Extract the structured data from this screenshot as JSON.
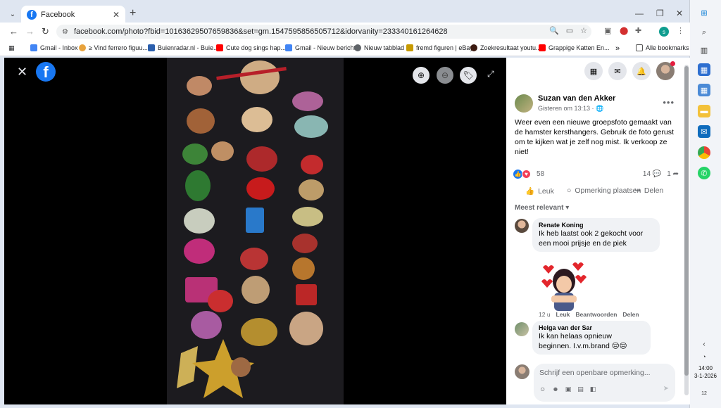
{
  "browser": {
    "tab": {
      "title": "Facebook"
    },
    "url": "facebook.com/photo?fbid=10163629507659836&set=gm.1547595856505712&idorvanity=233340161264628",
    "bookmarks": [
      {
        "label": "Gmail - Inbox",
        "icon": "google-icon",
        "color": "#4285f4"
      },
      {
        "label": "≥ Vind ferrero figuu...",
        "icon": "number-badge-icon",
        "color": "#e8a33d"
      },
      {
        "label": "Buienradar.nl - Buie...",
        "icon": "buienradar-icon",
        "color": "#2b5fad"
      },
      {
        "label": "Cute dog sings hap...",
        "icon": "youtube-icon",
        "color": "#ff0000"
      },
      {
        "label": "Gmail - Nieuw bericht",
        "icon": "google-icon",
        "color": "#4285f4"
      },
      {
        "label": "Nieuw tabblad",
        "icon": "globe-icon",
        "color": "#5f6368"
      },
      {
        "label": "fremd figuren | eBay",
        "icon": "ebay-icon",
        "color": "#c79a00"
      },
      {
        "label": "Zoekresultaat youtu...",
        "icon": "circle-icon",
        "color": "#3c1a10"
      },
      {
        "label": "Grappige Katten En...",
        "icon": "youtube-icon",
        "color": "#ff0000"
      }
    ],
    "all_bookmarks": "Alle bookmarks",
    "profile_initial": "s"
  },
  "post": {
    "author": "Suzan van den Akker",
    "time": "Gisteren om 13:13 · ",
    "text": "Weer even een nieuwe groepsfoto gemaakt van de hamster kersthangers. Gebruik de foto gerust om te kijken wat je zelf nog mist. Ik verkoop ze niet!",
    "reaction_count": "58",
    "comment_count": "14",
    "share_count": "1",
    "actions": {
      "like": "Leuk",
      "comment": "Opmerking plaatsen",
      "share": "Delen"
    },
    "sort": "Meest relevant"
  },
  "comments": [
    {
      "name": "Renate Koning",
      "text": "Ik heb laatst ook 2 gekocht voor een mooi prijsje en de piek"
    },
    {
      "meta": {
        "time": "12 u",
        "like": "Leuk",
        "reply": "Beantwoorden",
        "share": "Delen"
      }
    },
    {
      "name": "Helga van der Sar",
      "text": "Ik kan helaas opnieuw beginnen. I.v.m.brand 😔😔"
    }
  ],
  "composer": {
    "placeholder": "Schrijf een openbare opmerking..."
  },
  "taskbar": {
    "time": "14:00",
    "date": "3-1-2026",
    "notifications": "12"
  },
  "colors": {
    "facebook_blue": "#1877f2",
    "viewer_bg": "#000000",
    "bubble": "#f0f2f5"
  }
}
